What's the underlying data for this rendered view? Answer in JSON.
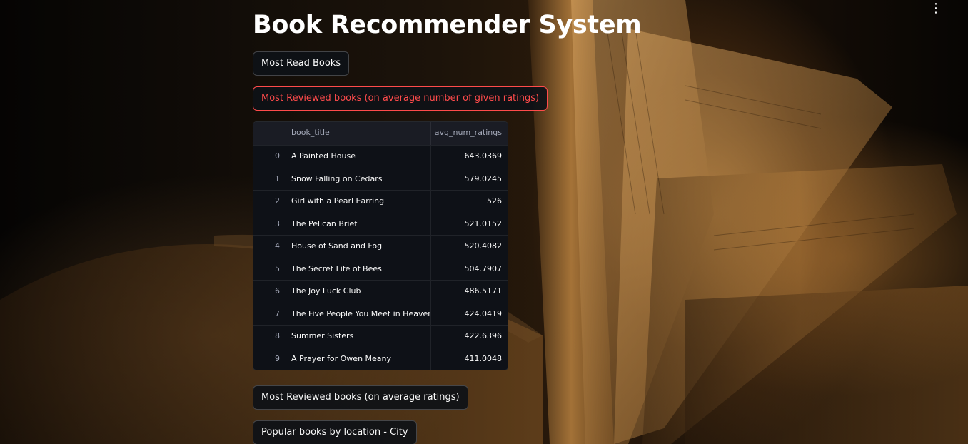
{
  "app": {
    "title": "Book Recommender System",
    "menu_icon": "vertical-ellipsis-icon"
  },
  "buttons": {
    "most_read": "Most Read Books",
    "most_reviewed_num": "Most Reviewed books (on average number of given ratings)",
    "most_reviewed_avg": "Most Reviewed books (on average ratings)",
    "popular_city": "Popular books by location - City"
  },
  "table": {
    "columns": [
      "",
      "book_title",
      "avg_num_ratings"
    ],
    "rows": [
      {
        "index": "0",
        "book_title": "A Painted House",
        "avg_num_ratings": "643.0369"
      },
      {
        "index": "1",
        "book_title": "Snow Falling on Cedars",
        "avg_num_ratings": "579.0245"
      },
      {
        "index": "2",
        "book_title": "Girl with a Pearl Earring",
        "avg_num_ratings": "526"
      },
      {
        "index": "3",
        "book_title": "The Pelican Brief",
        "avg_num_ratings": "521.0152"
      },
      {
        "index": "4",
        "book_title": "House of Sand and Fog",
        "avg_num_ratings": "520.4082"
      },
      {
        "index": "5",
        "book_title": "The Secret Life of Bees",
        "avg_num_ratings": "504.7907"
      },
      {
        "index": "6",
        "book_title": "The Joy Luck Club",
        "avg_num_ratings": "486.5171"
      },
      {
        "index": "7",
        "book_title": "The Five People You Meet in Heaven",
        "avg_num_ratings": "424.0419"
      },
      {
        "index": "8",
        "book_title": "Summer Sisters",
        "avg_num_ratings": "422.6396"
      },
      {
        "index": "9",
        "book_title": "A Prayer for Owen Meany",
        "avg_num_ratings": "411.0048"
      }
    ]
  },
  "colors": {
    "accent": "#ff4b4b",
    "background": "#0e1117",
    "text": "#fafafa"
  }
}
